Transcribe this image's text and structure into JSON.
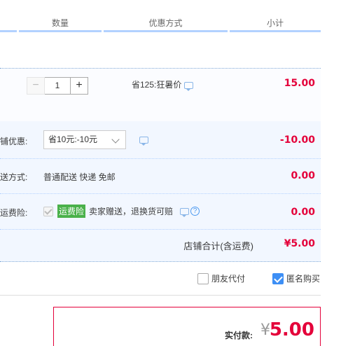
{
  "header": {
    "cols": [
      "",
      "数量",
      "优惠方式",
      "小计"
    ]
  },
  "item": {
    "quantity": "1",
    "decrease_label": "−",
    "increase_label": "+",
    "promotion": "省125:狂暑价",
    "subtotal": "15.00"
  },
  "shop_discount": {
    "label": "铺优惠:",
    "selected": "省10元:-10元",
    "amount": "-10.00"
  },
  "shipping": {
    "label": "送方式:",
    "method": "普通配送 快递 免邮",
    "amount": "0.00"
  },
  "insurance": {
    "label": "运费险:",
    "tag": "运费险",
    "text": "卖家赠送，退换货可赔",
    "help": "?",
    "amount": "0.00"
  },
  "shop_total": {
    "label": "店铺合计(含运费)",
    "amount": "¥5.00"
  },
  "options": {
    "friend_pay": "朋友代付",
    "anonymous": "匿名购买",
    "anonymous_checked": true
  },
  "payment": {
    "label": "实付款:",
    "currency": "¥",
    "amount": "5.00"
  }
}
